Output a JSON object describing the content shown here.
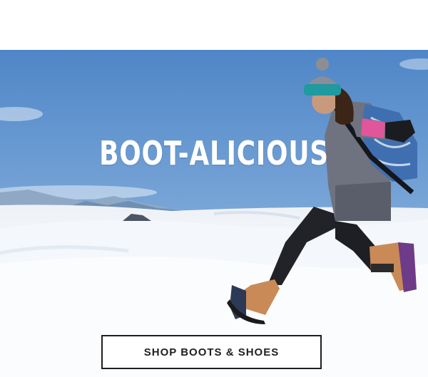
{
  "hero": {
    "headline": "BOOT-ALICIOUS",
    "image_alt": "hiker-jumping-in-snow"
  },
  "cta": {
    "label": "SHOP BOOTS & SHOES"
  },
  "colors": {
    "sky_top": "#4f86c7",
    "sky_bottom": "#a9c8e6",
    "snow": "#f2f5f9",
    "button_border": "#1f1f1f",
    "beanie": "#1e9aa0",
    "sleeve_pink": "#e0569a",
    "backpack": "#3f6fb0",
    "boot": "#c98a57"
  }
}
